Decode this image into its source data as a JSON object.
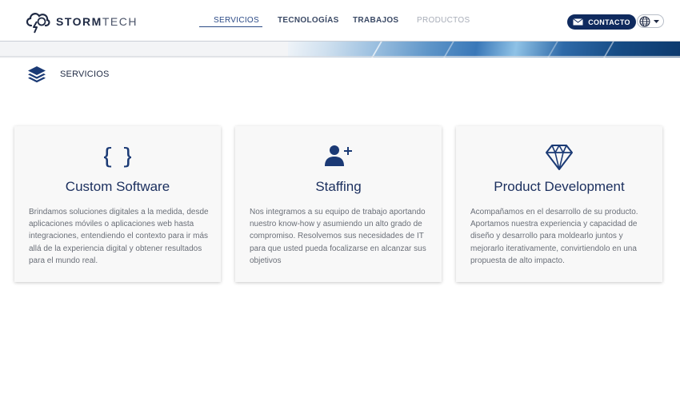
{
  "header": {
    "logo_text_bold": "STORM",
    "logo_text_thin": "TECH",
    "nav": [
      {
        "label": "SERVICIOS",
        "state": "active"
      },
      {
        "label": "TECNOLOGÍAS",
        "state": "normal"
      },
      {
        "label": "TRABAJOS",
        "state": "normal"
      },
      {
        "label": "PRODUCTOS",
        "state": "disabled"
      }
    ],
    "contact_label": "CONTACTO",
    "language_icon": "globe-icon"
  },
  "section": {
    "icon": "layers-icon",
    "title": "SERVICIOS"
  },
  "cards": [
    {
      "icon": "curly-braces-icon",
      "title": "Custom Software",
      "description": "Brindamos soluciones digitales a la medida, desde aplicaciones móviles o aplicaciones web hasta integraciones, entendiendo el contexto para ir más allá de la experiencia digital y obtener resultados para el mundo real."
    },
    {
      "icon": "add-user-icon",
      "title": "Staffing",
      "description": "Nos integramos a su equipo de trabajo aportando nuestro know-how y asumiendo un alto grado de compromiso. Resolvemos sus necesidades de IT para que usted pueda focalizarse en alcanzar sus objetivos"
    },
    {
      "icon": "diamond-icon",
      "title": "Product Development",
      "description": "Acompañamos en el desarrollo de su producto. Aportamos nuestra experiencia y capacidad de diseño y desarrollo para moldearlo juntos y mejorarlo iterativamente, convirtiendolo en una propuesta de alto impacto."
    }
  ],
  "colors": {
    "primary": "#1b2f5e",
    "accent": "#2b4a86",
    "contact_bg": "#0f2a5e",
    "text_muted": "#6a6f78"
  }
}
